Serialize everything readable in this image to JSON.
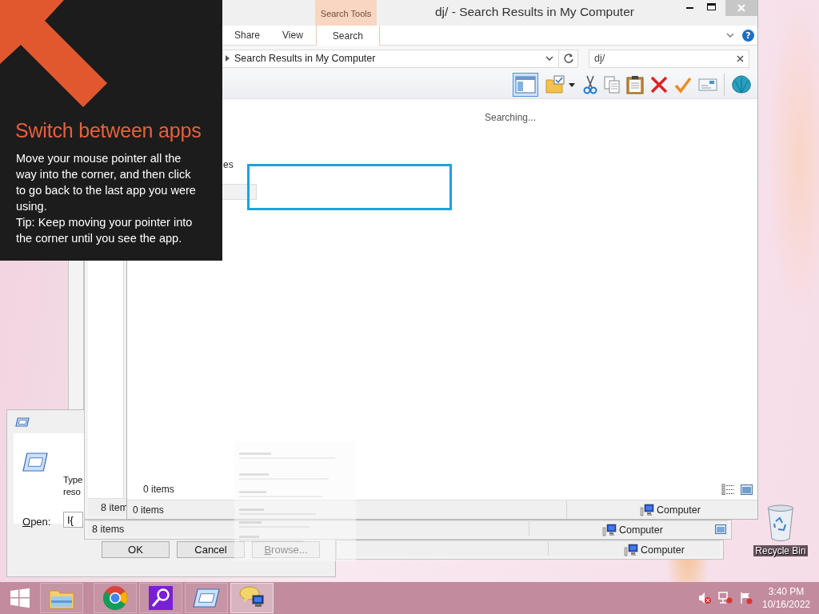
{
  "tip": {
    "title": "Switch between apps",
    "paragraphs": [
      "Move your mouse pointer all the way into the corner, and then click to go back to the last app you were using.",
      "Tip: Keep moving your pointer into the corner until you see the app."
    ]
  },
  "run_dialog": {
    "prompt_lines": [
      "Type",
      "reso"
    ],
    "open_label": "Open:",
    "value": "I{",
    "buttons": [
      "OK",
      "Cancel",
      "Browse..."
    ]
  },
  "back_windows": [
    {
      "status_left": "8 item"
    },
    {
      "status_left": "8 items",
      "status_right": "Computer"
    },
    {
      "status_right": "Computer"
    }
  ],
  "explorer": {
    "context_header": "Search Tools",
    "title": "dj/ - Search Results in My Computer",
    "tabs": [
      {
        "label": "Share",
        "selected": false
      },
      {
        "label": "View",
        "selected": false
      },
      {
        "label": "Search",
        "selected": true
      }
    ],
    "help_glyph": "?",
    "address": "Search Results in My Computer",
    "search_value": "dj/",
    "toolbar": [
      {
        "kind": "preview-pane",
        "selected": true
      },
      {
        "kind": "folder-options",
        "selected": false
      },
      {
        "kind": "dropdown",
        "selected": false
      },
      {
        "kind": "cut",
        "selected": false
      },
      {
        "kind": "copy",
        "selected": false
      },
      {
        "kind": "paste",
        "selected": false
      },
      {
        "kind": "delete",
        "selected": false
      },
      {
        "kind": "apply",
        "selected": false
      },
      {
        "kind": "email",
        "selected": false
      },
      {
        "kind": "shell",
        "selected": false
      }
    ],
    "status_message": "Searching...",
    "partial_label": "es",
    "item_count": "0 items",
    "status_left": "0 items",
    "status_right": "Computer"
  },
  "desktop_icons": [
    {
      "label": "Recycle Bin"
    }
  ],
  "taskbar": {
    "apps": [
      {
        "kind": "folder",
        "selected": false
      },
      {
        "kind": "browser",
        "selected": false
      },
      {
        "kind": "magnifier",
        "selected": false
      },
      {
        "kind": "run",
        "selected": false
      },
      {
        "kind": "chat",
        "selected": true
      }
    ],
    "time": "3:40 PM",
    "date": "10/16/2022"
  }
}
